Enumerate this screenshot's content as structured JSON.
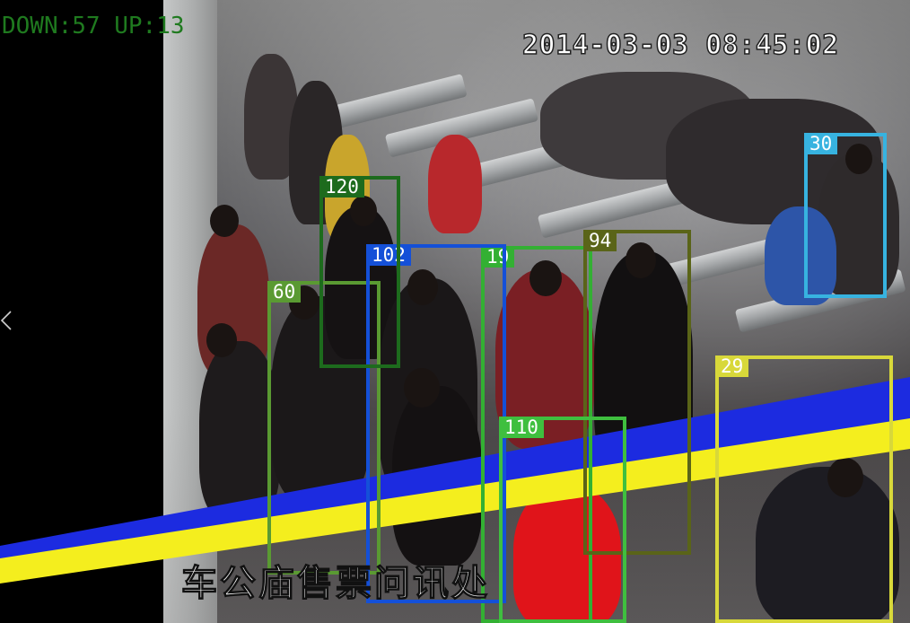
{
  "overlay": {
    "counter_down": "DOWN:57",
    "counter_up": "UP:13",
    "timestamp": "2014-03-03 08:45:02",
    "caption": "车公庙售票问讯处"
  },
  "colors": {
    "counter_text": "#1f7a1f",
    "count_line_blue": "#1c2be0",
    "count_line_yellow": "#f4ee1e"
  },
  "icons": {
    "prev": "chevron-left-icon"
  },
  "tracks": [
    {
      "id": "120",
      "color": "#1d6b1d"
    },
    {
      "id": "102",
      "color": "#1450d8"
    },
    {
      "id": "19",
      "color": "#33b033"
    },
    {
      "id": "94",
      "color": "#5a6418"
    },
    {
      "id": "30",
      "color": "#37b3e0"
    },
    {
      "id": "60",
      "color": "#5a9a32"
    },
    {
      "id": "110",
      "color": "#3fbf3f"
    },
    {
      "id": "29",
      "color": "#d8d83a"
    }
  ]
}
